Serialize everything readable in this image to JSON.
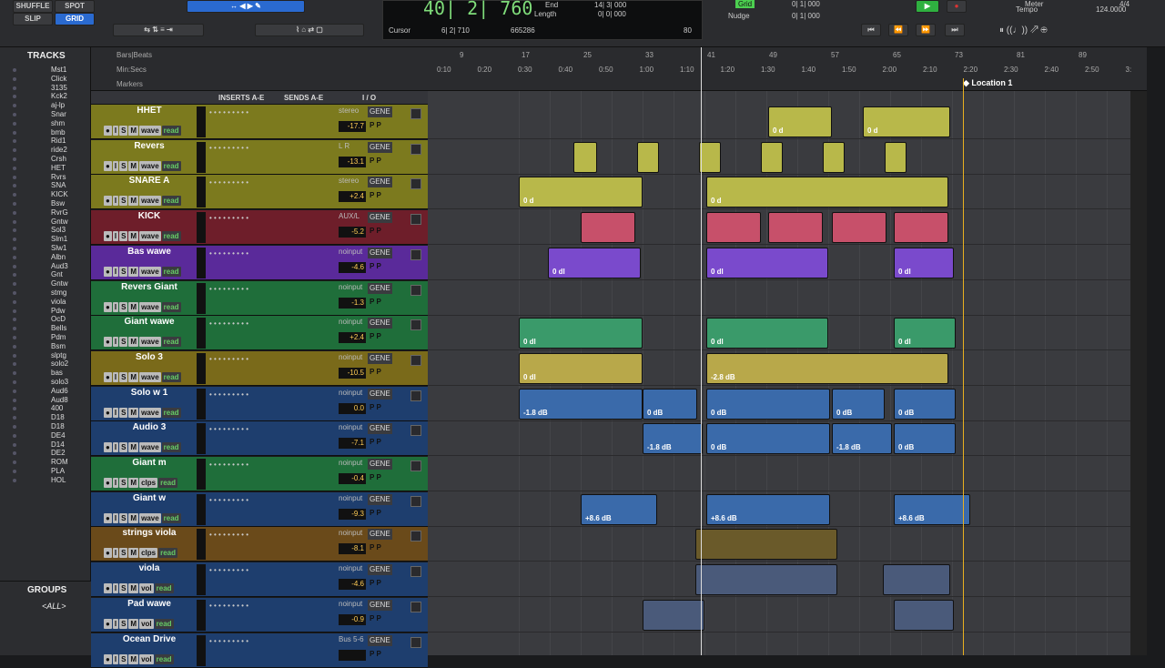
{
  "top": {
    "modes": [
      "SHUFFLE",
      "SPOT",
      "SLIP",
      "GRID"
    ],
    "counter_main": "40| 2| 760",
    "counter_sub": "665286",
    "cursor_label": "Cursor",
    "cursor_val": "6| 2| 710",
    "end_label": "End",
    "length_label": "Length",
    "end_val": "14| 3| 000",
    "length_val": "0| 0| 000",
    "grid_label": "Grid",
    "grid_val": "0| 1| 000",
    "nudge_label": "Nudge",
    "nudge_val": "0| 1| 000",
    "zoom_val": "80",
    "tempo_label": "Tempo",
    "tempo_val": "124.0000",
    "meter_label": "Meter",
    "meter_val": "4/4"
  },
  "ruler": {
    "bars_label": "Bars|Beats",
    "min_label": "Min:Secs",
    "markers_label": "Markers",
    "location": "Location 1",
    "bars": [
      "9",
      "17",
      "25",
      "33",
      "41",
      "49",
      "57",
      "65",
      "73",
      "81",
      "89"
    ],
    "secs": [
      "0:10",
      "0:20",
      "0:30",
      "0:40",
      "0:50",
      "1:00",
      "1:10",
      "1:20",
      "1:30",
      "1:40",
      "1:50",
      "2:00",
      "2:10",
      "2:20",
      "2:30",
      "2:40",
      "2:50",
      "3:"
    ]
  },
  "left": {
    "title": "TRACKS",
    "tracks": [
      "Mst1",
      "Click",
      "3135",
      "Kck2",
      "aj-lp",
      "Snar",
      "shm",
      "bmb",
      "Rid1",
      "ride2",
      "Crsh",
      "HET",
      "Rvrs",
      "SNA",
      "KICK",
      "Bsw",
      "RvrG",
      "Gntw",
      "Sol3",
      "Slm1",
      "Slw1",
      "Albn",
      "Aud3",
      "Gnt",
      "Gntw",
      "stmg",
      "viola",
      "Pdw",
      "OcD",
      "Bells",
      "Pdm",
      "Bsm",
      "slptg",
      "solo2",
      "bas",
      "solo3",
      "Aud6",
      "Aud8",
      "400",
      "D18",
      "D18",
      "DE4",
      "D14",
      "DE2",
      "ROM",
      "PLA",
      "HOL"
    ],
    "groups_title": "GROUPS",
    "groups_all": "<ALL>"
  },
  "header": {
    "inserts": "INSERTS A-E",
    "sends": "SENDS A-E",
    "io": "I / O"
  },
  "tracks": [
    {
      "name": "HHET",
      "color": "#7c7a1e",
      "view": "wave",
      "io": "stereo",
      "vol": "-17.7"
    },
    {
      "name": "Revers",
      "color": "#7c7a1e",
      "view": "wave",
      "io": "L R",
      "vol": "-13.1"
    },
    {
      "name": "SNARE A",
      "color": "#7c7a1e",
      "view": "wave",
      "io": "stereo",
      "vol": "+2.4"
    },
    {
      "name": "KICK",
      "color": "#6e1e2a",
      "view": "wave",
      "io": "AUX/L",
      "vol": "-5.2"
    },
    {
      "name": "Bas wawe",
      "color": "#5a2a9a",
      "view": "wave",
      "io": "noinput",
      "vol": "-4.6"
    },
    {
      "name": "Revers Giant",
      "color": "#1f6e3a",
      "view": "wave",
      "io": "noinput",
      "vol": "-1.3"
    },
    {
      "name": "Giant wawe",
      "color": "#1f6e3a",
      "view": "wave",
      "io": "noinput",
      "vol": "+2.4"
    },
    {
      "name": "Solo 3",
      "color": "#7a6a1a",
      "view": "wave",
      "io": "noinput",
      "vol": "-10.5"
    },
    {
      "name": "Solo w 1",
      "color": "#1e3e6e",
      "view": "wave",
      "io": "noinput",
      "vol": "0.0"
    },
    {
      "name": "Audio 3",
      "color": "#1e3e6e",
      "view": "wave",
      "io": "noinput",
      "vol": "-7.1"
    },
    {
      "name": "Giant m",
      "color": "#1f6e3a",
      "view": "clps",
      "io": "noinput",
      "vol": "-0.4"
    },
    {
      "name": "Giant w",
      "color": "#1e3e6e",
      "view": "wave",
      "io": "noinput",
      "vol": "-9.3"
    },
    {
      "name": "strings viola",
      "color": "#6a4a1a",
      "view": "clps",
      "io": "noinput",
      "vol": "-8.1"
    },
    {
      "name": "viola",
      "color": "#1e3e6e",
      "view": "vol",
      "io": "noinput",
      "vol": "-4.6"
    },
    {
      "name": "Pad wawe",
      "color": "#1e3e6e",
      "view": "vol",
      "io": "noinput",
      "vol": "-0.9"
    },
    {
      "name": "Ocean Drive",
      "color": "#1e3e6e",
      "view": "vol",
      "io": "Bus 5-6",
      "vol": ""
    }
  ],
  "common": {
    "gene": "GENE",
    "rec": "read",
    "s": "S",
    "m": "M",
    "i": "I",
    "p": "P"
  },
  "clips": [
    {
      "lane": 0,
      "color": "#b8b84a",
      "items": [
        [
          374,
          70,
          "0 d"
        ],
        [
          478,
          96,
          "0 d"
        ]
      ]
    },
    {
      "lane": 1,
      "color": "#b8b84a",
      "items": [
        [
          160,
          26,
          ""
        ],
        [
          230,
          24,
          ""
        ],
        [
          298,
          24,
          ""
        ],
        [
          366,
          24,
          ""
        ],
        [
          434,
          24,
          ""
        ],
        [
          502,
          24,
          ""
        ]
      ]
    },
    {
      "lane": 2,
      "color": "#b8b84a",
      "items": [
        [
          100,
          136,
          "0 d"
        ],
        [
          306,
          266,
          "0 d"
        ]
      ]
    },
    {
      "lane": 3,
      "color": "#c7506a",
      "items": [
        [
          168,
          60,
          ""
        ],
        [
          306,
          60,
          ""
        ],
        [
          374,
          60,
          ""
        ],
        [
          444,
          60,
          ""
        ],
        [
          512,
          60,
          ""
        ]
      ]
    },
    {
      "lane": 4,
      "color": "#7a4acc",
      "items": [
        [
          132,
          102,
          "0 dl"
        ],
        [
          306,
          134,
          "0 dl"
        ],
        [
          512,
          66,
          "0 dl"
        ]
      ]
    },
    {
      "lane": 6,
      "color": "#3a9a6a",
      "items": [
        [
          100,
          136,
          "0 dl"
        ],
        [
          306,
          134,
          "0 dl"
        ],
        [
          512,
          68,
          "0 dl"
        ]
      ]
    },
    {
      "lane": 7,
      "color": "#b8a84a",
      "items": [
        [
          100,
          136,
          "0 dl"
        ],
        [
          306,
          266,
          "-2.8 dB"
        ]
      ]
    },
    {
      "lane": 8,
      "color": "#3a6aaa",
      "items": [
        [
          100,
          136,
          "-1.8 dB"
        ],
        [
          236,
          60,
          "0 dB"
        ],
        [
          306,
          136,
          "0 dB"
        ],
        [
          444,
          58,
          "0 dB"
        ],
        [
          512,
          68,
          "0 dB"
        ]
      ]
    },
    {
      "lane": 9,
      "color": "#3a6aaa",
      "items": [
        [
          236,
          66,
          "-1.8 dB"
        ],
        [
          306,
          136,
          "0 dB"
        ],
        [
          444,
          66,
          "-1.8 dB"
        ],
        [
          512,
          68,
          "0 dB"
        ]
      ]
    },
    {
      "lane": 11,
      "color": "#3a6aaa",
      "items": [
        [
          168,
          84,
          "+8.6 dB"
        ],
        [
          306,
          136,
          "+8.6 dB"
        ],
        [
          512,
          84,
          "+8.6 dB"
        ]
      ]
    },
    {
      "lane": 12,
      "color": "#6a5a2a",
      "items": [
        [
          294,
          156,
          ""
        ]
      ]
    },
    {
      "lane": 13,
      "color": "#4a5a7a",
      "items": [
        [
          294,
          156,
          ""
        ],
        [
          500,
          74,
          ""
        ]
      ]
    },
    {
      "lane": 14,
      "color": "#4a5a7a",
      "items": [
        [
          236,
          68,
          ""
        ],
        [
          512,
          66,
          ""
        ]
      ]
    }
  ],
  "colors": {
    "cursor": "#dddddd",
    "location": "#e8b020"
  }
}
